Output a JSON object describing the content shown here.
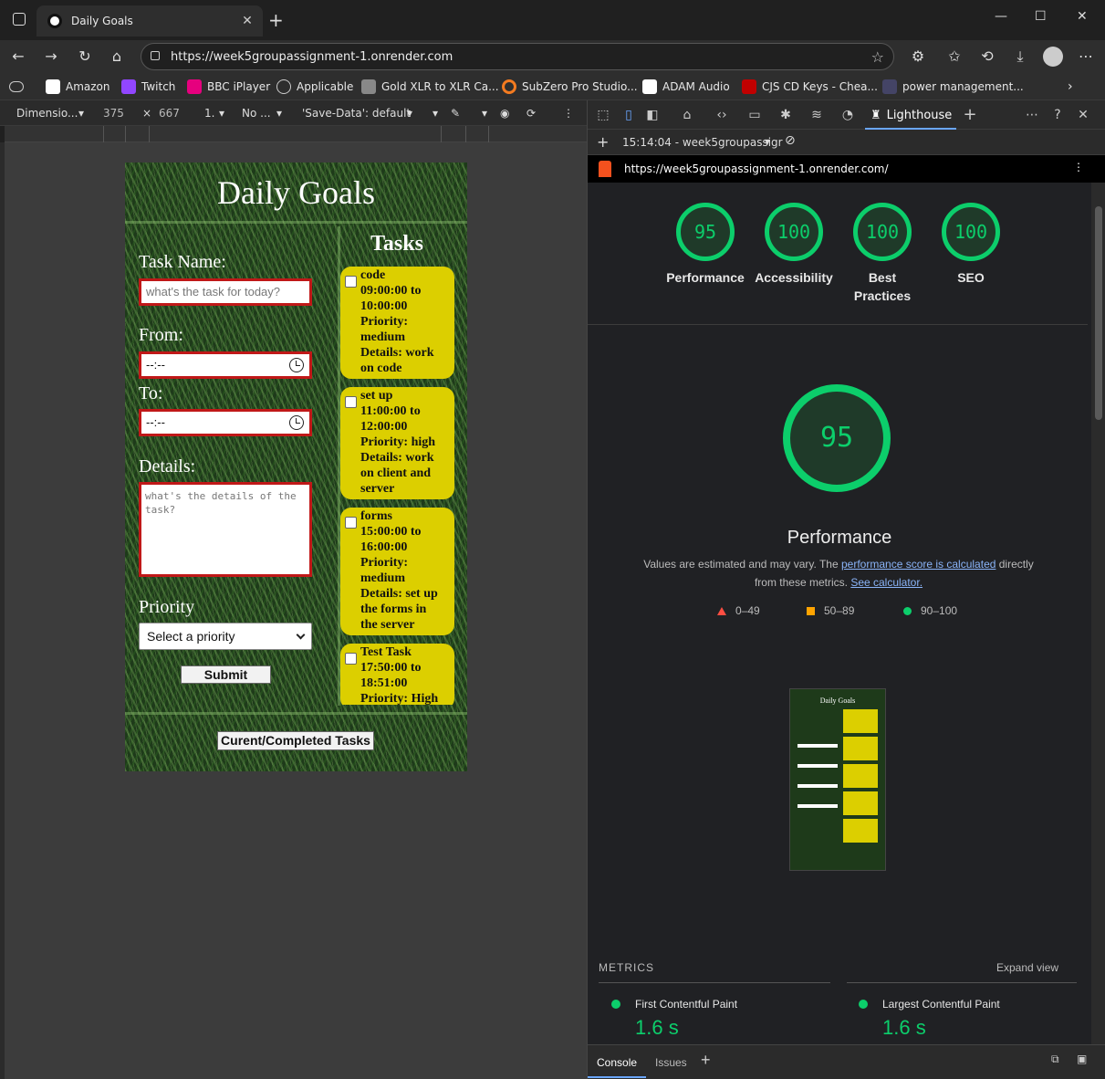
{
  "browser": {
    "tab_title": "Daily Goals",
    "url": "https://week5groupassignment-1.onrender.com",
    "bookmarks": [
      {
        "label": "Amazon",
        "color": "#ffffff"
      },
      {
        "label": "Twitch",
        "color": "#9146ff"
      },
      {
        "label": "BBC iPlayer",
        "color": "#e6007e"
      },
      {
        "label": "Applicable",
        "color": "#888888"
      },
      {
        "label": "Gold XLR to XLR Ca...",
        "color": "#888888"
      },
      {
        "label": "SubZero Pro Studio...",
        "color": "#f47b20"
      },
      {
        "label": "ADAM Audio",
        "color": "#ffffff"
      },
      {
        "label": "CJS CD Keys - Chea...",
        "color": "#c00000"
      },
      {
        "label": "power management...",
        "color": "#444466"
      }
    ]
  },
  "device_toolbar": {
    "dimensions": "Dimensio...",
    "width": "375",
    "times": "×",
    "height": "667",
    "zoom": "1.",
    "throttle": "No ...",
    "save_data": "'Save-Data': default"
  },
  "app": {
    "title": "Daily Goals",
    "task_name_label": "Task Name:",
    "task_name_placeholder": "what's the task for today?",
    "from_label": "From:",
    "from_value": "--:--",
    "to_label": "To:",
    "to_value": "--:--",
    "details_label": "Details:",
    "details_placeholder": "what's the details of the task?",
    "priority_label": "Priority",
    "priority_selected": "Select a priority",
    "submit_label": "Submit",
    "tasks_title": "Tasks",
    "toggle_label": "Curent/Completed Tasks",
    "tasks": [
      {
        "lines": [
          "code",
          "09:00:00 to",
          "10:00:00",
          "Priority:",
          "medium",
          "Details: work",
          "on code"
        ]
      },
      {
        "lines": [
          "set up",
          "11:00:00 to",
          "12:00:00",
          "Priority: high",
          "Details: work",
          "on client and",
          "server"
        ]
      },
      {
        "lines": [
          "forms",
          "15:00:00 to",
          "16:00:00",
          "Priority:",
          "medium",
          "Details: set up",
          "the forms in",
          "the server"
        ]
      },
      {
        "lines": [
          "Test Task",
          "17:50:00 to",
          "18:51:00",
          "Priority: High"
        ]
      }
    ]
  },
  "devtools": {
    "panel": "Lighthouse",
    "report_time": "15:14:04 - week5groupassigr",
    "report_url": "https://week5groupassignment-1.onrender.com/",
    "scores": [
      {
        "label": "Performance",
        "value": "95"
      },
      {
        "label": "Accessibility",
        "value": "100"
      },
      {
        "label": "Best Practices",
        "value": "100"
      },
      {
        "label": "SEO",
        "value": "100"
      }
    ],
    "big_score": "95",
    "big_label": "Performance",
    "note_pre": "Values are estimated and may vary. The ",
    "note_link1": "performance score is calculated",
    "note_mid": " directly from these metrics. ",
    "note_link2": "See calculator.",
    "legend": [
      "0–49",
      "50–89",
      "90–100"
    ],
    "colors": {
      "fail": "#ff4e42",
      "average": "#ffa400",
      "pass": "#0cce6b"
    },
    "thumb_title": "Daily Goals",
    "metrics_header": "METRICS",
    "expand_label": "Expand view",
    "metrics": [
      {
        "name": "First Contentful Paint",
        "value": "1.6 s"
      },
      {
        "name": "Largest Contentful Paint",
        "value": "1.6 s"
      }
    ],
    "drawer_tabs": [
      "Console",
      "Issues"
    ]
  }
}
